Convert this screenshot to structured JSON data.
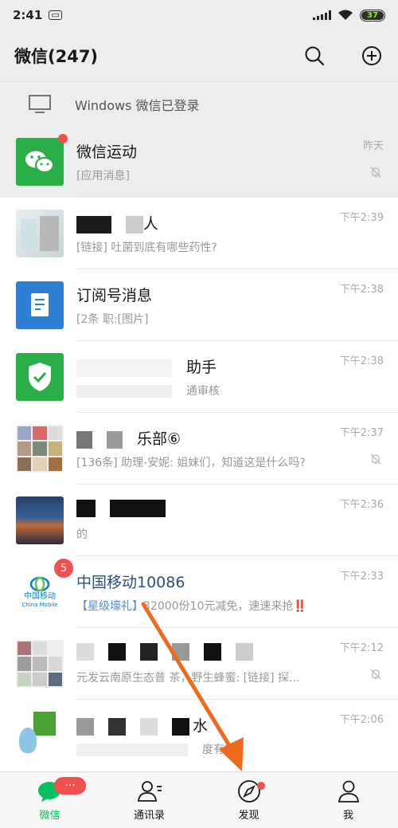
{
  "status": {
    "time": "2:41",
    "battery": "37"
  },
  "header": {
    "title": "微信(247)",
    "search_icon": "search-icon",
    "add_icon": "plus-circle-icon"
  },
  "login_banner": {
    "text": "Windows 微信已登录"
  },
  "chats": [
    {
      "name": "微信运动",
      "preview": "[应用消息]",
      "time": "昨天",
      "muted": true
    },
    {
      "name": "人",
      "preview": "[链接]  吐菌到底有哪些药性?",
      "time": "下午2:39",
      "muted": false
    },
    {
      "name": "订阅号消息",
      "preview": "[2条  职:[图片]",
      "time": "下午2:38",
      "muted": false
    },
    {
      "name": "助手",
      "preview": "通审核",
      "time": "下午2:38",
      "muted": false
    },
    {
      "name": "乐部⑥",
      "preview": "[136条] 助理-安妮: 姐妹们，知道这是什么吗?",
      "time": "下午2:37",
      "muted": true
    },
    {
      "name": "",
      "preview": "的",
      "time": "下午2:36",
      "muted": false
    },
    {
      "name": "中国移动10086",
      "preview_highlight": "【星级壕礼】",
      "preview": "32000份10元减免，速速来抢‼️",
      "time": "下午2:33",
      "muted": false,
      "badge": "5"
    },
    {
      "name": "",
      "preview": "元发云南原生态普  茶，野生蜂蜜: [链接] 探...",
      "time": "下午2:12",
      "muted": true
    },
    {
      "name": "水",
      "preview": "度有?",
      "time": "下午2:06",
      "muted": false
    }
  ],
  "avatar_texts": {
    "china_mobile": "中国移动",
    "china_mobile_en": "China Mobile"
  },
  "tabs": [
    {
      "label": "微信",
      "badge": "···",
      "icon": "chat-icon"
    },
    {
      "label": "通讯录",
      "icon": "contacts-icon"
    },
    {
      "label": "发现",
      "icon": "compass-icon",
      "dot": true
    },
    {
      "label": "我",
      "icon": "person-icon"
    }
  ],
  "colors": {
    "wechat_green": "#07c160",
    "badge_red": "#f15050",
    "arrow_orange": "#f06a1d"
  }
}
